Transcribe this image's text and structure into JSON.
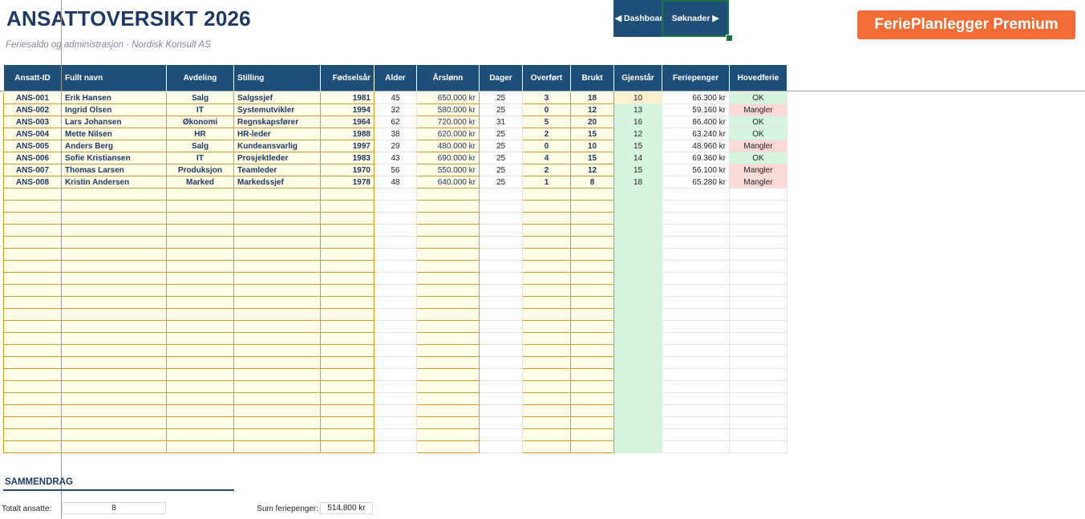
{
  "header": {
    "title": "ANSATTOVERSIKT 2026",
    "subtitle": "Feriesaldo og administrasjon · Nordisk Konsult AS"
  },
  "nav": {
    "dashboard_label": "◀ Dashboard",
    "soknader_label": "Søknader ▶"
  },
  "premium_label": "FeriePlanlegger Premium",
  "table": {
    "columns": [
      "Ansatt-ID",
      "Fullt navn",
      "Avdeling",
      "Stilling",
      "Fødselsår",
      "Alder",
      "Årslønn",
      "Dager",
      "Overført",
      "Brukt",
      "Gjenstår",
      "Feriepenger",
      "Hovedferie"
    ],
    "rows": [
      [
        "ANS-001",
        "Erik Hansen",
        "Salg",
        "Salgssjef",
        "1981",
        "45",
        "650.000 kr",
        "25",
        "3",
        "18",
        "10",
        "66.300 kr",
        "OK"
      ],
      [
        "ANS-002",
        "Ingrid Olsen",
        "IT",
        "Systemutvikler",
        "1994",
        "32",
        "580.000 kr",
        "25",
        "0",
        "12",
        "13",
        "59.160 kr",
        "Mangler"
      ],
      [
        "ANS-003",
        "Lars Johansen",
        "Økonomi",
        "Regnskapsfører",
        "1964",
        "62",
        "720.000 kr",
        "31",
        "5",
        "20",
        "16",
        "86.400 kr",
        "OK"
      ],
      [
        "ANS-004",
        "Mette Nilsen",
        "HR",
        "HR-leder",
        "1988",
        "38",
        "620.000 kr",
        "25",
        "2",
        "15",
        "12",
        "63.240 kr",
        "OK"
      ],
      [
        "ANS-005",
        "Anders Berg",
        "Salg",
        "Kundeansvarlig",
        "1997",
        "29",
        "480.000 kr",
        "25",
        "0",
        "10",
        "15",
        "48.960 kr",
        "Mangler"
      ],
      [
        "ANS-006",
        "Sofie Kristiansen",
        "IT",
        "Prosjektleder",
        "1983",
        "43",
        "690.000 kr",
        "25",
        "4",
        "15",
        "14",
        "69.360 kr",
        "OK"
      ],
      [
        "ANS-007",
        "Thomas Larsen",
        "Produksjon",
        "Teamleder",
        "1970",
        "56",
        "550.000 kr",
        "25",
        "2",
        "12",
        "15",
        "56.100 kr",
        "Mangler"
      ],
      [
        "ANS-008",
        "Kristin Andersen",
        "Marked",
        "Markedssjef",
        "1978",
        "48",
        "640.000 kr",
        "25",
        "1",
        "8",
        "18",
        "65.280 kr",
        "Mangler"
      ]
    ]
  },
  "summary": {
    "heading": "SAMMENDRAG",
    "total_label": "Totalt ansatte:",
    "total_value": "8",
    "sum_label": "Sum feriepenger:",
    "sum_value": "514.800 kr"
  }
}
